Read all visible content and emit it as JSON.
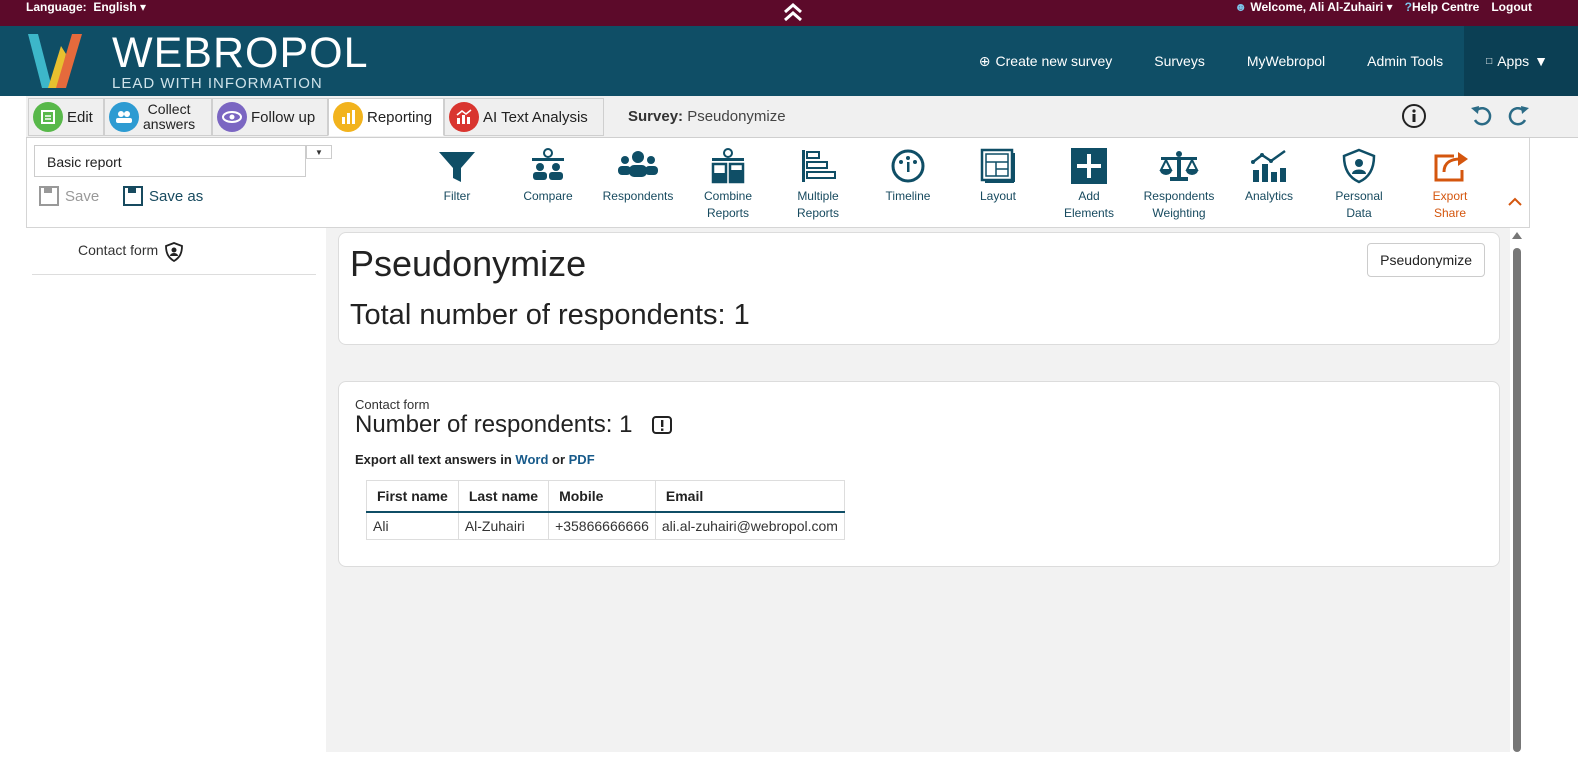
{
  "topbar": {
    "language_label": "Language:",
    "language_value": "English",
    "welcome": "Welcome, Ali Al-Zuhairi",
    "help": "Help Centre",
    "logout": "Logout"
  },
  "header": {
    "logo_wordmark": "WEBROPOL",
    "logo_tagline": "LEAD WITH INFORMATION",
    "nav": {
      "create": "Create new survey",
      "surveys": "Surveys",
      "mywebropol": "MyWebropol",
      "admin": "Admin Tools",
      "apps": "Apps"
    }
  },
  "tabs": {
    "edit": "Edit",
    "collect_line1": "Collect",
    "collect_line2": "answers",
    "follow": "Follow up",
    "reporting": "Reporting",
    "ai": "AI Text Analysis",
    "survey_label": "Survey:",
    "survey_name": "Pseudonymize"
  },
  "toolbar": {
    "report_select": "Basic report",
    "save": "Save",
    "save_as": "Save as",
    "tools": {
      "filter": "Filter",
      "compare": "Compare",
      "respondents": "Respondents",
      "combine_1": "Combine",
      "combine_2": "Reports",
      "multiple_1": "Multiple",
      "multiple_2": "Reports",
      "timeline": "Timeline",
      "layout": "Layout",
      "add_1": "Add",
      "add_2": "Elements",
      "weighting_1": "Respondents",
      "weighting_2": "Weighting",
      "analytics": "Analytics",
      "personal_1": "Personal",
      "personal_2": "Data",
      "export_1": "Export",
      "export_2": "Share"
    }
  },
  "sidebar": {
    "item": "Contact form"
  },
  "report": {
    "title": "Pseudonymize",
    "total": "Total number of respondents: 1",
    "pseudonymize_button": "Pseudonymize",
    "section_label": "Contact form",
    "section_count": "Number of respondents: 1",
    "export_text": "Export all text answers in",
    "export_word": "Word",
    "export_or": "or",
    "export_pdf": "PDF",
    "table": {
      "headers": [
        "First name",
        "Last name",
        "Mobile",
        "Email"
      ],
      "rows": [
        [
          "Ali",
          "Al-Zuhairi",
          "+35866666666",
          "ali.al-zuhairi@webropol.com"
        ]
      ]
    }
  },
  "colors": {
    "topbar": "#5c0a2a",
    "header": "#0f4e66",
    "accent_text": "#174a5f",
    "export": "#d4560e"
  }
}
